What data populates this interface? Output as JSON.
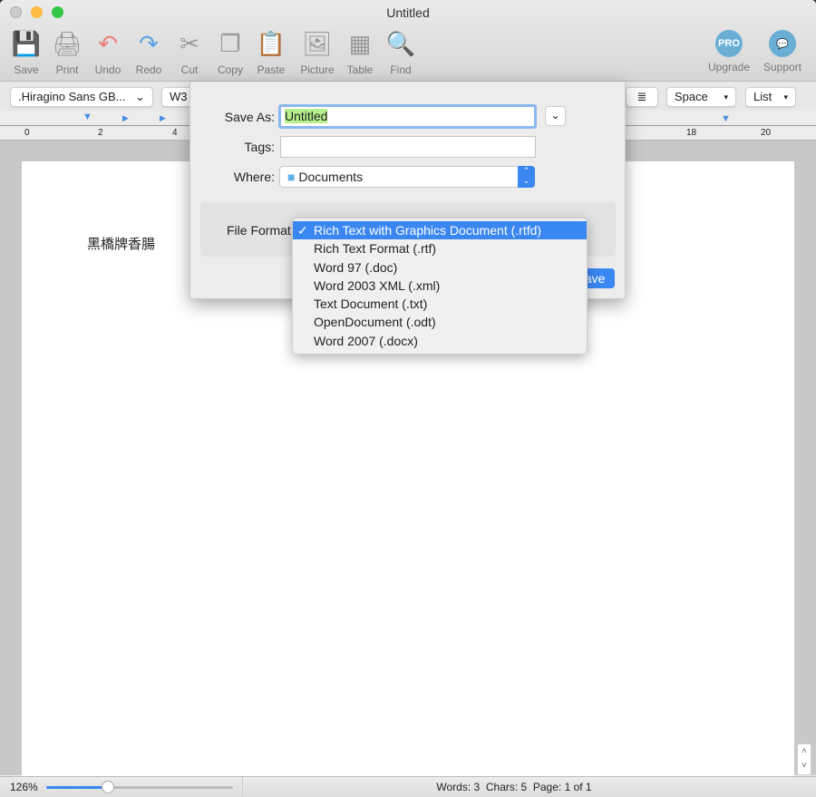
{
  "window": {
    "title": "Untitled"
  },
  "toolbar": [
    {
      "label": "Save",
      "icon": "save-icon"
    },
    {
      "label": "Print",
      "icon": "print-icon"
    },
    {
      "label": "Undo",
      "icon": "undo-icon"
    },
    {
      "label": "Redo",
      "icon": "redo-icon"
    },
    {
      "label": "Cut",
      "icon": "cut-icon"
    },
    {
      "label": "Copy",
      "icon": "copy-icon"
    },
    {
      "label": "Paste",
      "icon": "paste-icon"
    },
    {
      "label": "Picture",
      "icon": "picture-icon"
    },
    {
      "label": "Table",
      "icon": "table-icon"
    },
    {
      "label": "Find",
      "icon": "find-icon"
    }
  ],
  "toolbar_right": {
    "upgrade_label": "Upgrade",
    "upgrade_badge": "PRO",
    "support_label": "Support"
  },
  "format_bar": {
    "font": ".Hiragino Sans GB...",
    "weight": "W3",
    "spacing": "Space",
    "list": "List"
  },
  "ruler": {
    "ticks": [
      "0",
      "2",
      "4",
      "18",
      "20"
    ]
  },
  "document": {
    "text": "黑橋牌香腸"
  },
  "save_dialog": {
    "save_as_label": "Save As:",
    "save_as_value": "Untitled",
    "tags_label": "Tags:",
    "tags_value": "",
    "where_label": "Where:",
    "where_value": "Documents",
    "file_format_label": "File Format:",
    "save_button": "Save"
  },
  "format_menu": {
    "selected": "Rich Text with Graphics Document (.rtfd)",
    "items": [
      "Rich Text with Graphics Document (.rtfd)",
      "Rich Text Format (.rtf)",
      "Word 97 (.doc)",
      "Word 2003 XML (.xml)",
      "Text Document (.txt)",
      "OpenDocument (.odt)",
      "Word 2007 (.docx)"
    ]
  },
  "status": {
    "zoom": "126%",
    "zoom_fraction": 0.33,
    "stats": "Words: 3  Chars: 5  Page: 1 of 1"
  },
  "colors": {
    "accent": "#3a87f2",
    "highlight": "#b7f08a",
    "pro_badge": "#6aaed6"
  }
}
